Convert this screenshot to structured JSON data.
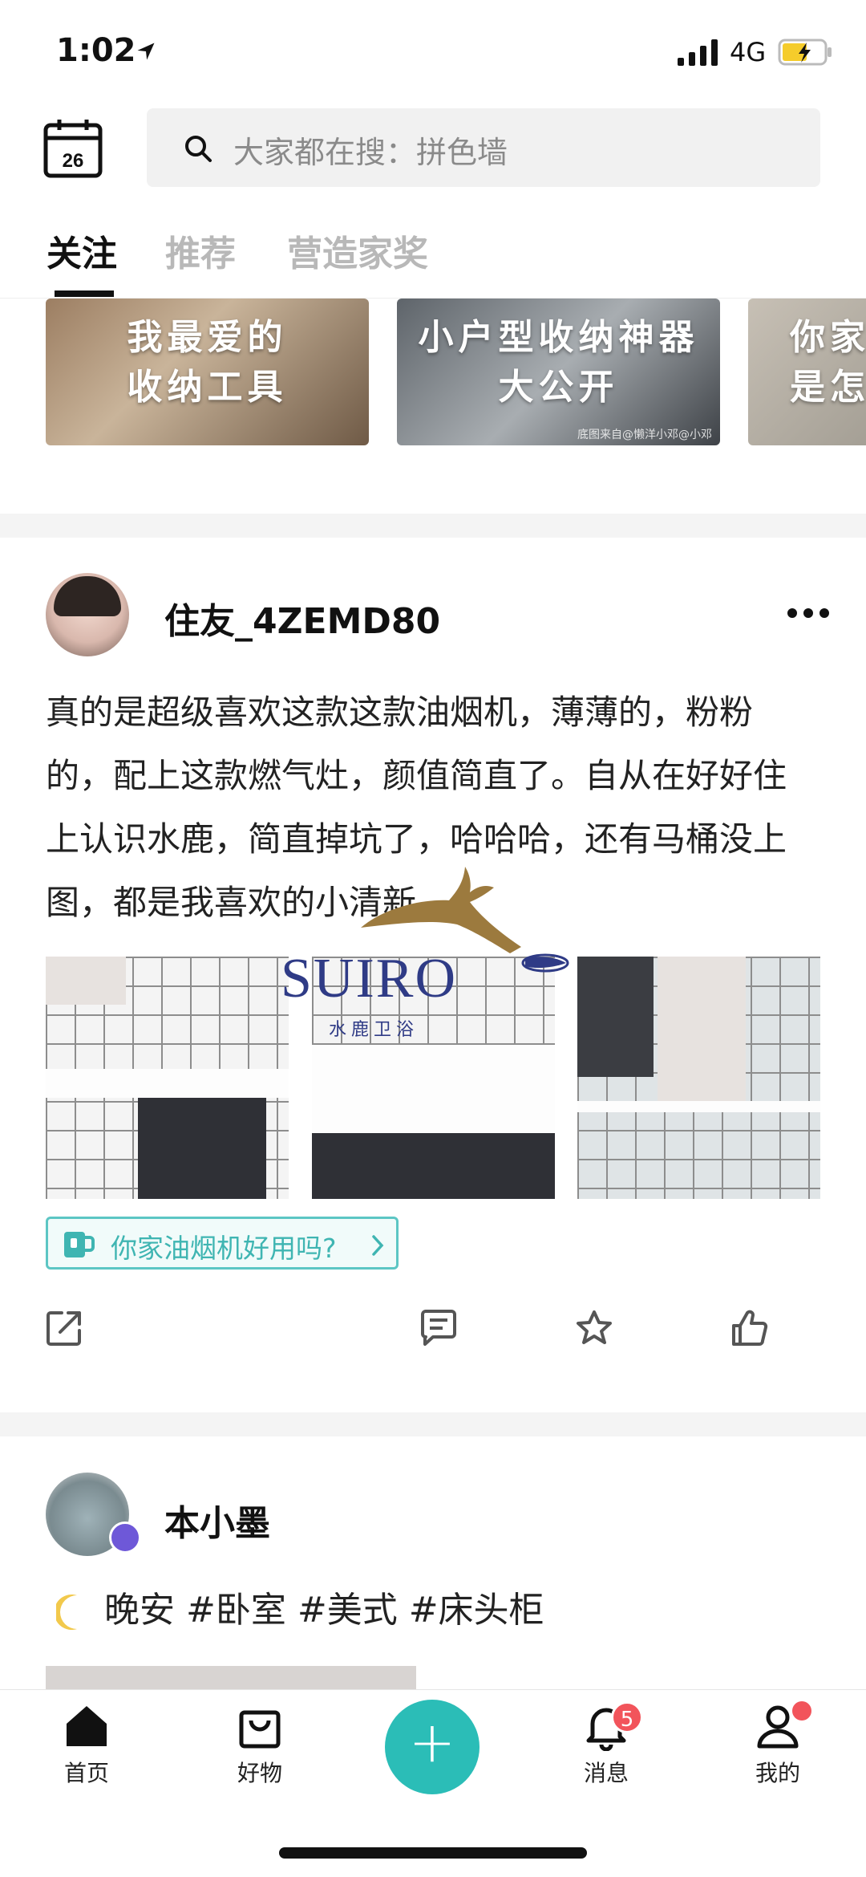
{
  "status_bar": {
    "time": "1:02",
    "network": "4G"
  },
  "search": {
    "placeholder": "大家都在搜：拼色墙"
  },
  "calendar": {
    "day": "26"
  },
  "tabs": [
    {
      "label": "关注",
      "active": true
    },
    {
      "label": "推荐",
      "active": false
    },
    {
      "label": "营造家奖",
      "active": false
    }
  ],
  "banners": [
    {
      "line1": "我最爱的",
      "line2": "收纳工具"
    },
    {
      "line1": "小户型收纳神器",
      "line2": "大公开",
      "credit": "底图来自@懒洋小邓@小邓"
    },
    {
      "line1": "你家",
      "line2": "是怎"
    }
  ],
  "post1": {
    "username": "住友_4ZEMD80",
    "text": "真的是超级喜欢这款这款油烟机，薄薄的，粉粉的，配上这款燃气灶，颜值简直了。自从在好好住上认识水鹿，简直掉坑了，哈哈哈，还有马桶没上图，都是我喜欢的小清新",
    "topic": "你家油烟机好用吗?"
  },
  "post2": {
    "username": "本小墨",
    "text": "晚安 #卧室 #美式 #床头柜"
  },
  "bottom_nav": [
    {
      "label": "首页",
      "icon": "home-icon"
    },
    {
      "label": "好物",
      "icon": "shopping-bag-icon"
    },
    {
      "label": "消息",
      "icon": "bell-icon",
      "badge": "5"
    },
    {
      "label": "我的",
      "icon": "profile-icon"
    }
  ],
  "fab": {
    "label": "+"
  },
  "watermark": {
    "brand": "SUIRO",
    "sub": "水鹿卫浴"
  },
  "colors": {
    "accent": "#2bbdb7",
    "badge": "#f2545b",
    "topic": "#3fb5b2"
  }
}
